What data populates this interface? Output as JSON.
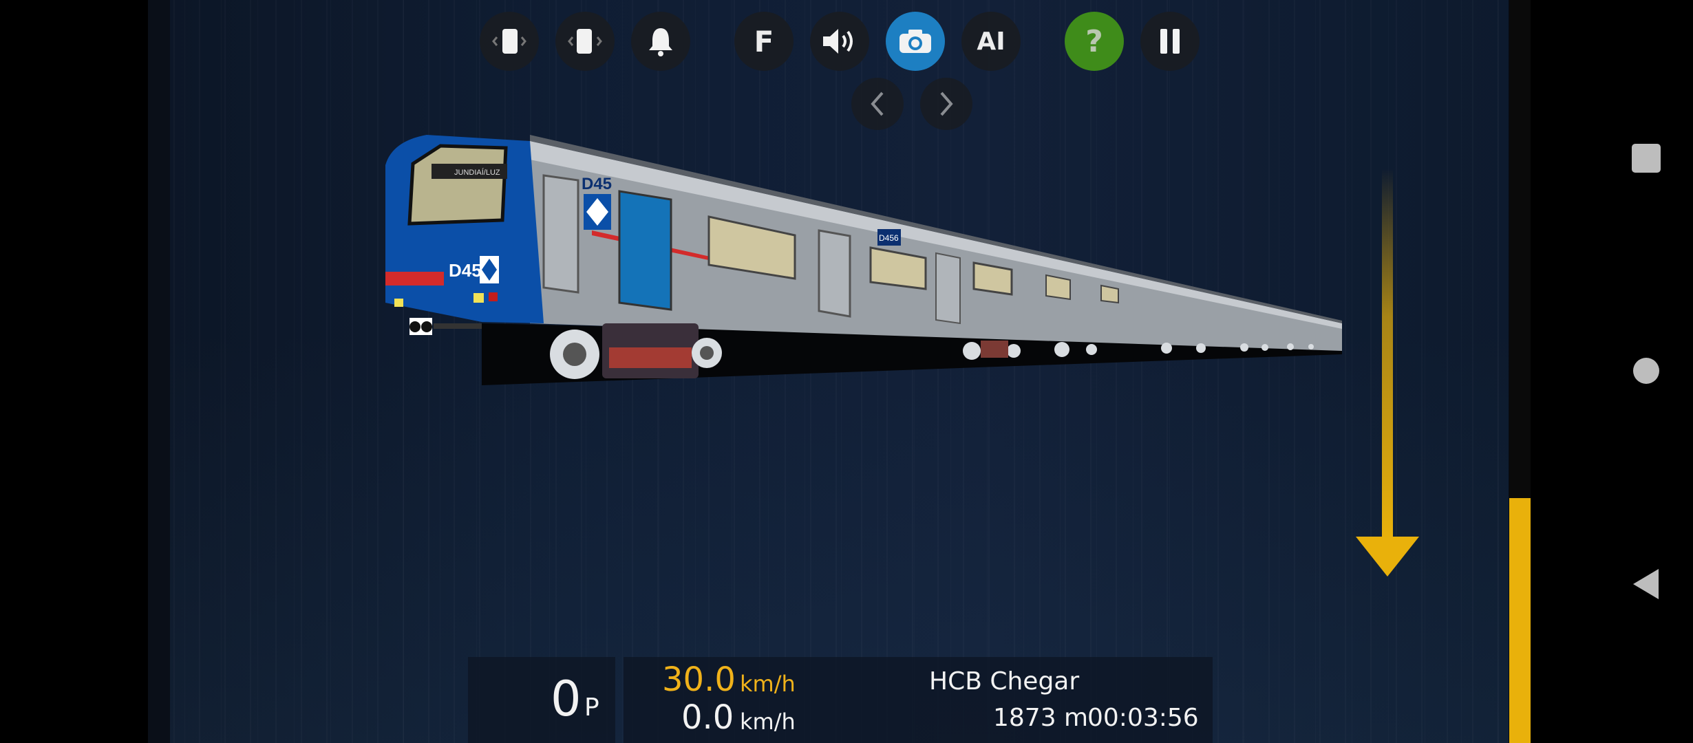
{
  "toolbar": {
    "buttons": [
      {
        "name": "cab-left",
        "icon": "door-left-icon"
      },
      {
        "name": "cab-right",
        "icon": "door-right-icon"
      },
      {
        "name": "bell",
        "icon": "bell-icon"
      },
      {
        "name": "forward",
        "icon": "letter-f-icon",
        "label": "F"
      },
      {
        "name": "sound",
        "icon": "speaker-icon"
      },
      {
        "name": "camera",
        "icon": "camera-icon",
        "selected": true
      },
      {
        "name": "ai",
        "icon": "ai-icon",
        "label": "AI"
      },
      {
        "name": "help",
        "icon": "question-icon",
        "label": "?"
      },
      {
        "name": "pause",
        "icon": "pause-icon"
      }
    ],
    "nav": [
      "chevron-left-icon",
      "chevron-right-icon"
    ]
  },
  "train": {
    "cab_number": "D45",
    "car_label": "D456",
    "destination_sign": "JUNDIAÍ/LUZ"
  },
  "hud": {
    "power_value": "0",
    "power_unit": "P",
    "target_speed_value": "30.0",
    "target_speed_unit": "km/h",
    "speed_value": "0.0",
    "speed_unit": "km/h",
    "station": "HCB Chegar",
    "distance": "1873 m",
    "time": "00:03:56"
  },
  "throttle": {
    "level_fraction": 0.33
  },
  "colors": {
    "accent_yellow": "#e9b10b",
    "camera_selected": "#1d7fc2",
    "help_green": "#3f8c1a",
    "train_blue": "#0b4fa8",
    "target_speed": "#f0b21a"
  },
  "system_nav": [
    "square-recent-icon",
    "circle-home-icon",
    "triangle-back-icon"
  ]
}
